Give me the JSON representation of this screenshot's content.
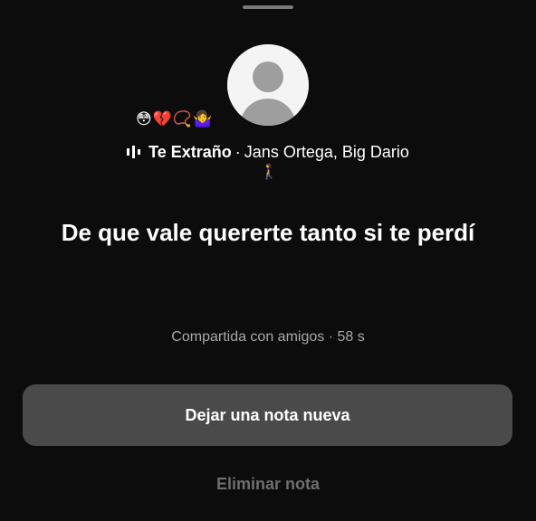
{
  "note": {
    "emojis": [
      "😳",
      "💔",
      "📿",
      "🤷‍♀️"
    ],
    "song": {
      "icon": "music-bars-icon",
      "title": "Te Extraño",
      "separator": "·",
      "artists": "Jans Ortega, Big Dario"
    },
    "walker_emoji": "🚶‍♀️",
    "text": "De que vale quererte tanto si te perdí",
    "meta": "Compartida con amigos · 58 s"
  },
  "actions": {
    "new_note_label": "Dejar una nota nueva",
    "delete_label": "Eliminar nota"
  },
  "colors": {
    "background": "#0c0c0c",
    "button": "#4a4a4a",
    "secondary_text": "#a8a8a8",
    "disabled_text": "#6e6e6e"
  }
}
